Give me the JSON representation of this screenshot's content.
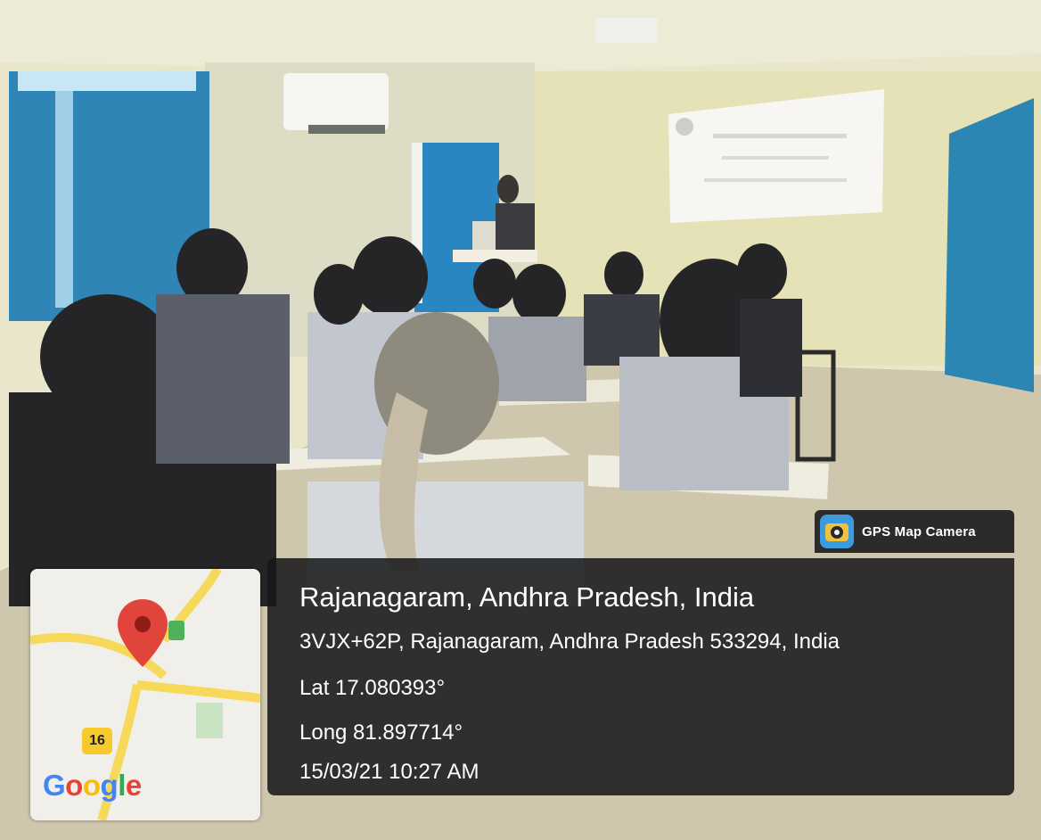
{
  "overlay": {
    "app_name": "GPS Map Camera",
    "place_title": "Rajanagaram, Andhra Pradesh, India",
    "address": "3VJX+62P, Rajanagaram, Andhra Pradesh 533294, India",
    "latitude": "Lat 17.080393°",
    "longitude": "Long 81.897714°",
    "datetime": "15/03/21 10:27 AM"
  },
  "map": {
    "route_shield": "16",
    "logo": [
      "G",
      "o",
      "o",
      "g",
      "l",
      "e"
    ],
    "logo_colors": [
      "#4285f4",
      "#ea4335",
      "#fbbc05",
      "#4285f4",
      "#34a853",
      "#ea4335"
    ],
    "pin_color": "#e0443a",
    "road_color": "#f6d95a"
  },
  "scene": {
    "wall_color": "#e7e4c8",
    "curtain_color": "#2f8ab8",
    "floor_color": "#cfc8b0"
  }
}
